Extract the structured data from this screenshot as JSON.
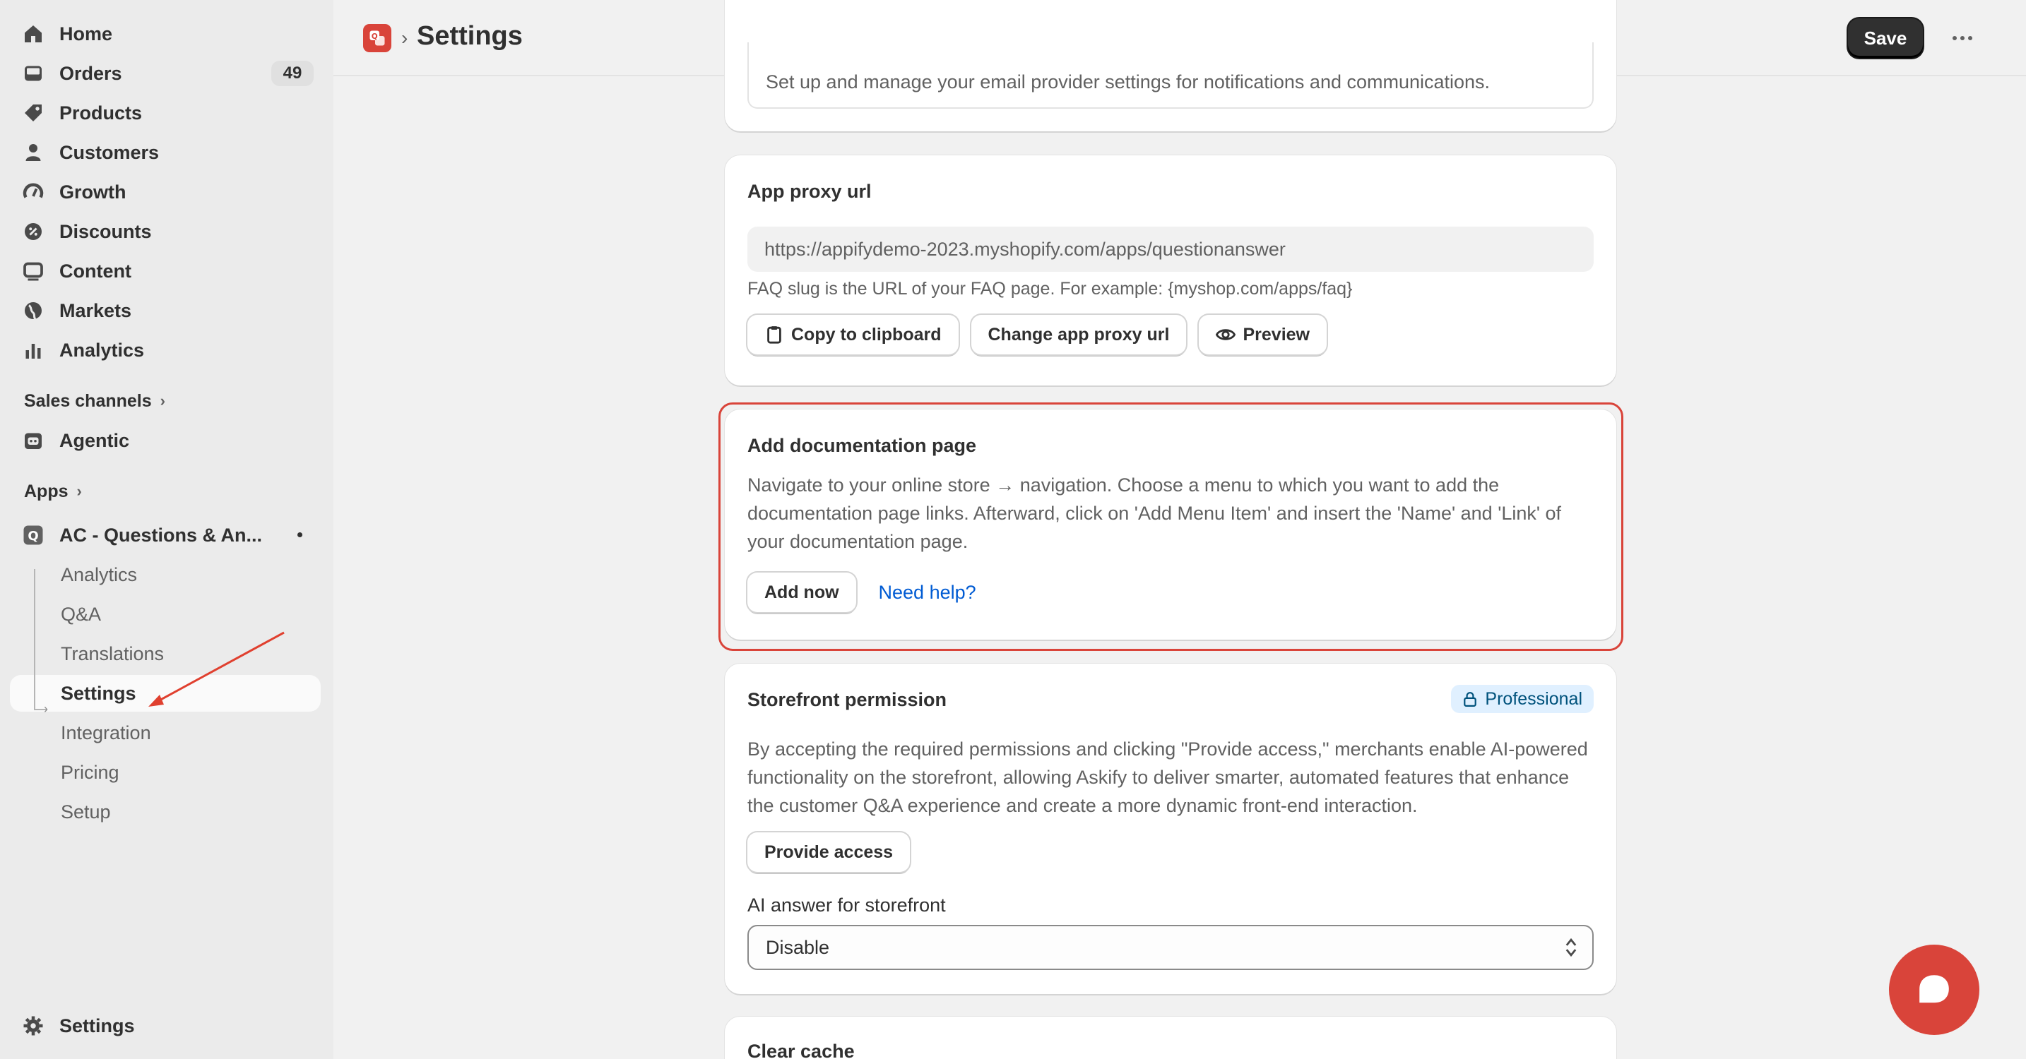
{
  "sidebar": {
    "main_items": [
      {
        "label": "Home",
        "icon": "home-icon"
      },
      {
        "label": "Orders",
        "icon": "inbox-icon",
        "badge": "49"
      },
      {
        "label": "Products",
        "icon": "tag-icon"
      },
      {
        "label": "Customers",
        "icon": "person-icon"
      },
      {
        "label": "Growth",
        "icon": "gauge-icon"
      },
      {
        "label": "Discounts",
        "icon": "discount-icon"
      },
      {
        "label": "Content",
        "icon": "content-icon"
      },
      {
        "label": "Markets",
        "icon": "globe-icon"
      },
      {
        "label": "Analytics",
        "icon": "bar-chart-icon"
      }
    ],
    "sales_channels_label": "Sales channels",
    "agentic_label": "Agentic",
    "apps_label": "Apps",
    "app_name": "AC - Questions & An...",
    "app_sub_items": [
      "Analytics",
      "Q&A",
      "Translations",
      "Settings",
      "Integration",
      "Pricing",
      "Setup"
    ],
    "active_sub_item": "Settings",
    "bottom_settings_label": "Settings"
  },
  "header": {
    "title": "Settings",
    "save_label": "Save"
  },
  "email_card": {
    "text": "Set up and manage your email provider settings for notifications and communications."
  },
  "proxy_card": {
    "title": "App proxy url",
    "url": "https://appifydemo-2023.myshopify.com/apps/questionanswer",
    "help": "FAQ slug is the URL of your FAQ page. For example: {myshop.com/apps/faq}",
    "copy_label": "Copy to clipboard",
    "change_label": "Change app proxy url",
    "preview_label": "Preview"
  },
  "doc_card": {
    "title": "Add documentation page",
    "text": "Navigate to your online store → navigation. Choose a menu to which you want to add the documentation page links. Afterward, click on 'Add Menu Item' and insert the 'Name' and 'Link' of your documentation page.",
    "add_label": "Add now",
    "help_label": "Need help?"
  },
  "storefront_card": {
    "title": "Storefront permission",
    "badge": "Professional",
    "text": "By accepting the required permissions and clicking \"Provide access,\" merchants enable AI-powered functionality on the storefront, allowing Askify to deliver smarter, automated features that enhance the customer Q&A experience and create a more dynamic front-end interaction.",
    "provide_label": "Provide access",
    "ai_label": "AI answer for storefront",
    "ai_value": "Disable"
  },
  "cache_card": {
    "title": "Clear cache"
  },
  "colors": {
    "accent": "#d9443a",
    "link": "#005bd3"
  }
}
